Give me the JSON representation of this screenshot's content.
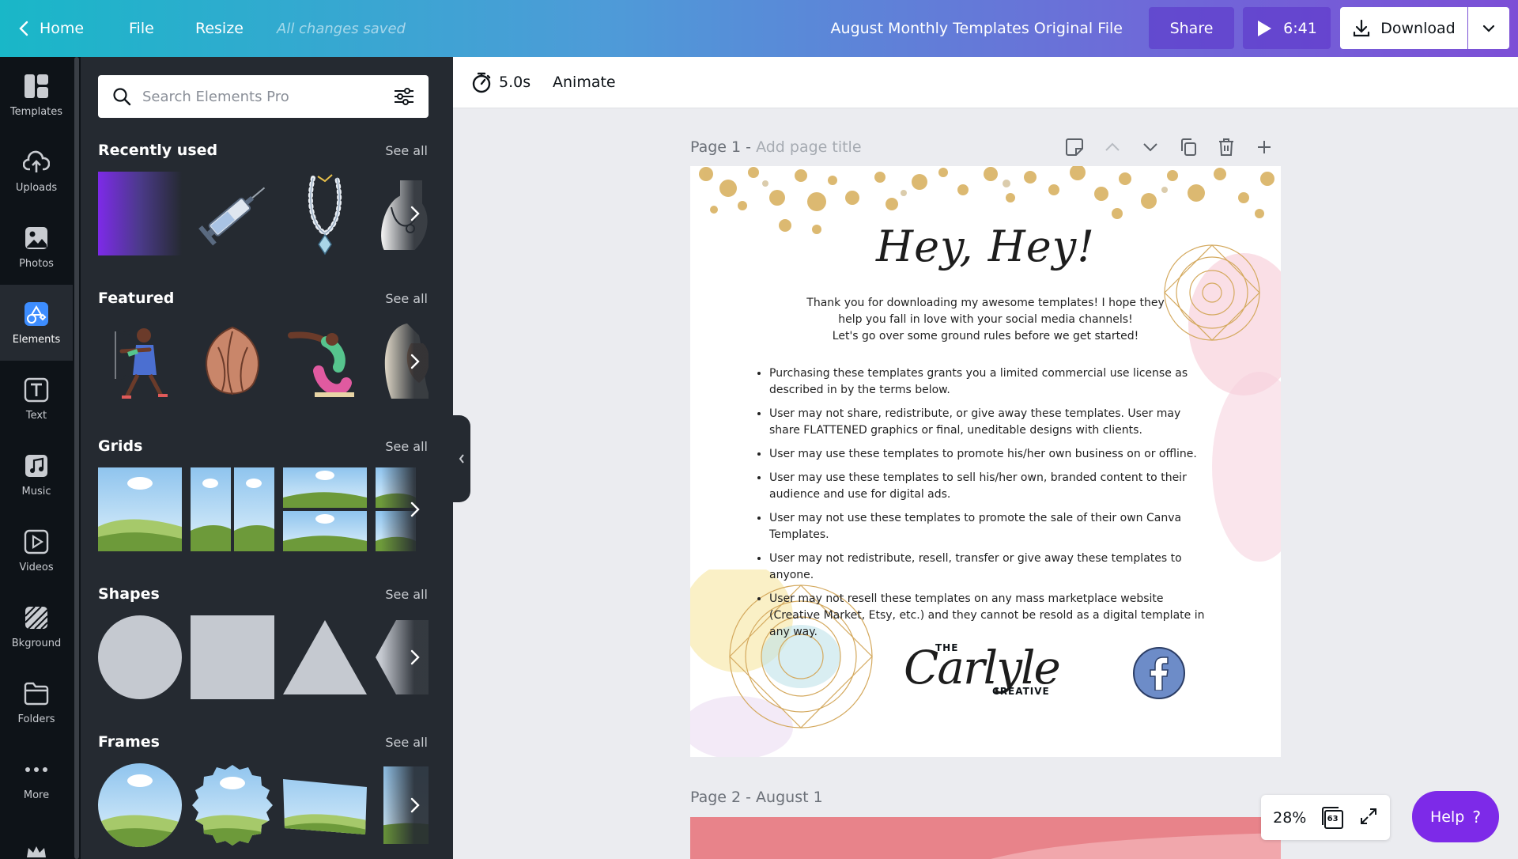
{
  "topbar": {
    "home_label": "Home",
    "file_label": "File",
    "resize_label": "Resize",
    "saved_status": "All changes saved",
    "doc_title": "August Monthly Templates Original File",
    "share_label": "Share",
    "play_duration": "6:41",
    "download_label": "Download"
  },
  "leftnav": {
    "items": [
      {
        "label": "Templates",
        "icon": "templates-icon"
      },
      {
        "label": "Uploads",
        "icon": "upload-cloud-icon"
      },
      {
        "label": "Photos",
        "icon": "photo-icon"
      },
      {
        "label": "Elements",
        "icon": "elements-shapes-icon"
      },
      {
        "label": "Text",
        "icon": "text-t-icon"
      },
      {
        "label": "Music",
        "icon": "music-note-icon"
      },
      {
        "label": "Videos",
        "icon": "play-video-icon"
      },
      {
        "label": "Bkground",
        "icon": "background-pattern-icon"
      },
      {
        "label": "Folders",
        "icon": "folder-icon"
      },
      {
        "label": "More",
        "icon": "more-dots-icon"
      }
    ],
    "active": "Elements"
  },
  "panel": {
    "search_placeholder": "Search Elements Pro",
    "see_all": "See all",
    "sections": {
      "recent": "Recently used",
      "featured": "Featured",
      "grids": "Grids",
      "shapes": "Shapes",
      "frames": "Frames"
    }
  },
  "toolbar": {
    "duration": "5.0s",
    "animate_label": "Animate"
  },
  "page1": {
    "label": "Page 1 - ",
    "title_placeholder": "Add page title",
    "heading": "Hey, Hey!",
    "intro_lines": [
      "Thank you for downloading my awesome templates! I hope they",
      "help you fall in love with your social media channels!",
      "Let's go over some ground rules before we get started!"
    ],
    "rules": [
      "Purchasing these templates grants you a limited commercial use license as described in by the terms below.",
      "User may not share, redistribute, or give away these templates. User may share FLATTENED graphics or final, uneditable designs with clients.",
      "User may use these templates to promote his/her own business on or offline.",
      "User may use these templates to sell his/her own, branded content to their audience and use for digital ads.",
      "User may not use these templates to promote the sale of their own Canva Templates.",
      "User may not redistribute, resell, transfer or give away these templates to anyone.",
      "User may not resell these templates on any mass marketplace website (Creative Market, Etsy, etc.) and they cannot be resold as a digital template in any way."
    ],
    "logo_the": "THE",
    "logo_script": "Carlyle",
    "logo_creative": "CREATIVE"
  },
  "page2": {
    "label": "Page 2 - August 1"
  },
  "zoom": {
    "level": "28%",
    "page_count": "63"
  },
  "help": {
    "label": "Help",
    "icon_glyph": "?"
  },
  "colors": {
    "accent_purple": "#7d2ae8",
    "panel_bg": "#252a31",
    "nav_bg": "#0e1318",
    "page2_pink": "#e8838a"
  }
}
